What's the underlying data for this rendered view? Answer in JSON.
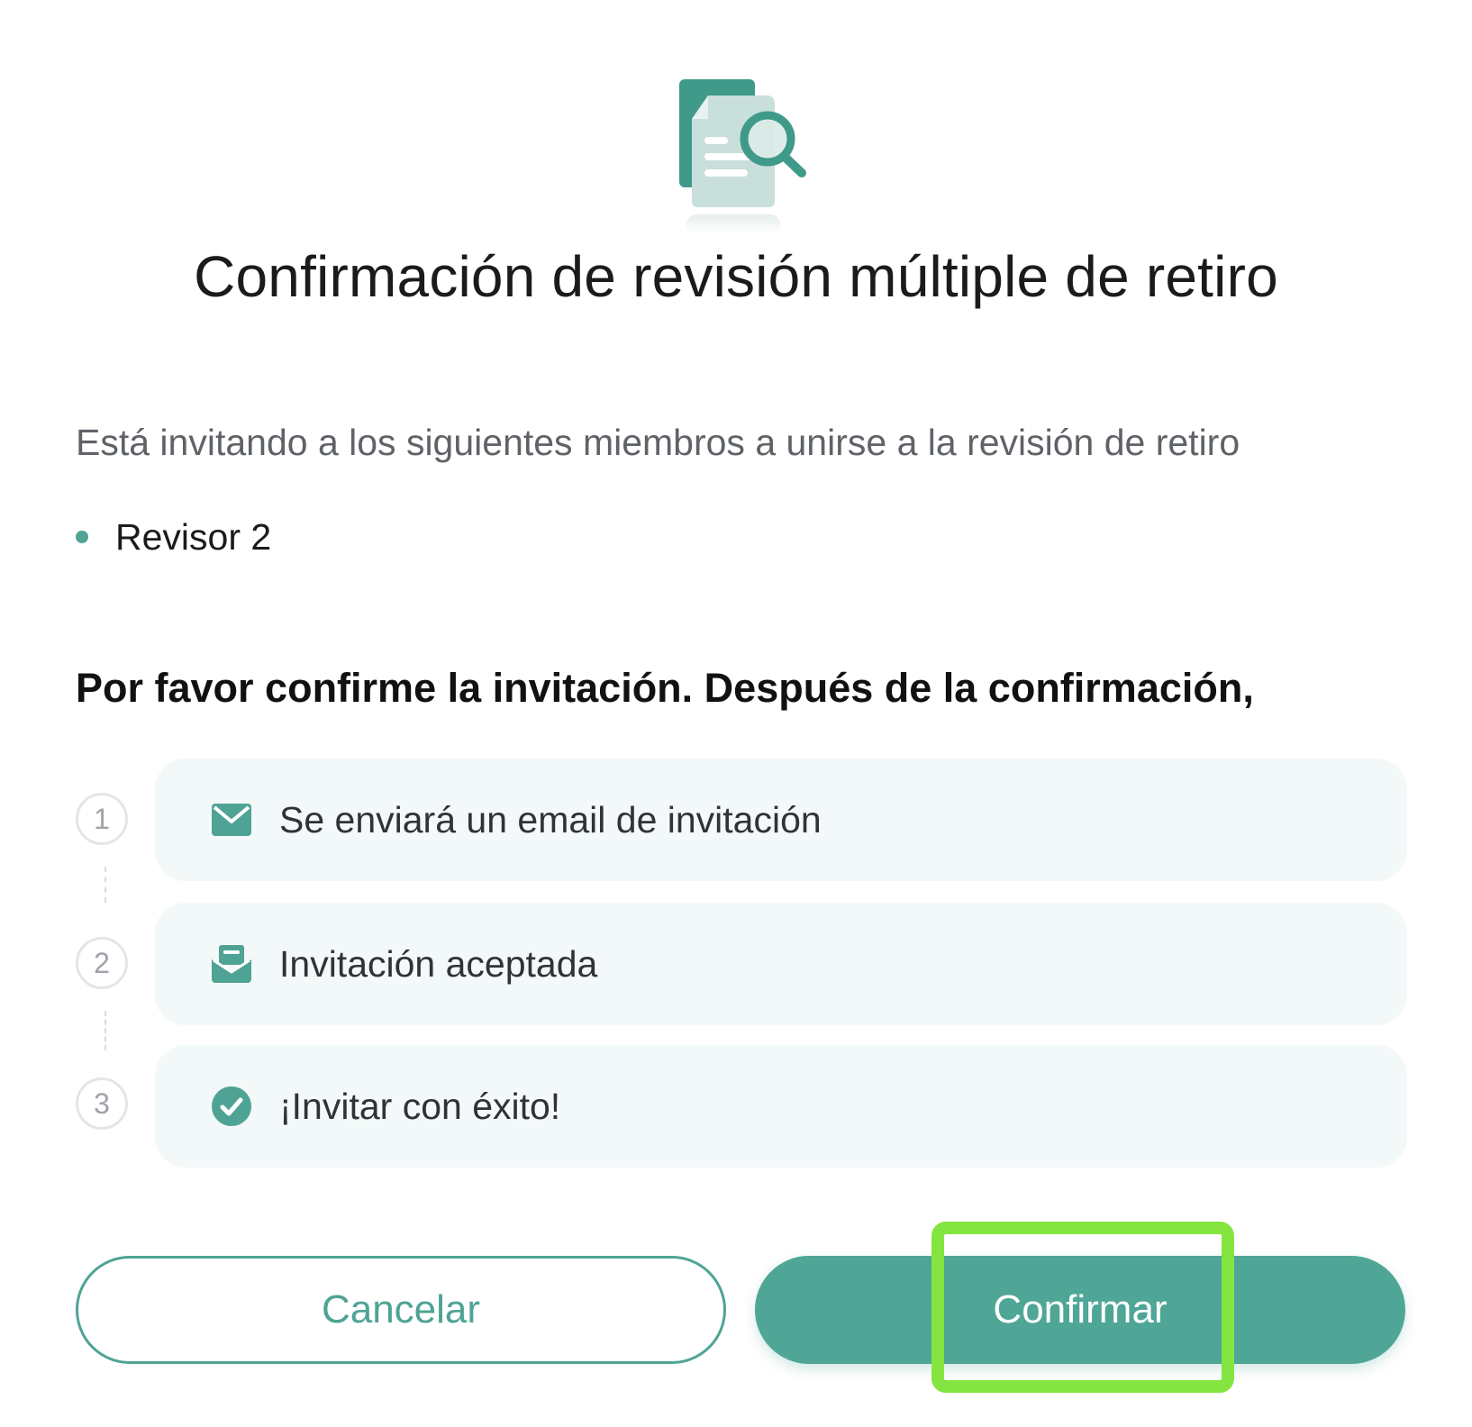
{
  "dialog": {
    "title": "Confirmación de revisión múltiple de retiro",
    "intro": "Está invitando a los siguientes miembros a unirse a la revisión de retiro",
    "members": [
      "Revisor 2"
    ],
    "confirm_note": "Por favor confirme la invitación. Después de la confirmación,",
    "steps": [
      {
        "number": "1",
        "icon": "envelope-icon",
        "label": "Se enviará un email de invitación"
      },
      {
        "number": "2",
        "icon": "open-envelope-icon",
        "label": "Invitación aceptada"
      },
      {
        "number": "3",
        "icon": "check-circle-icon",
        "label": "¡Invitar con éxito!"
      }
    ],
    "buttons": {
      "cancel": "Cancelar",
      "confirm": "Confirmar"
    }
  },
  "colors": {
    "accent": "#4fa696",
    "highlight": "#84e540",
    "card_bg": "#f3f8f8"
  },
  "hero_icon": "document-search-icon"
}
